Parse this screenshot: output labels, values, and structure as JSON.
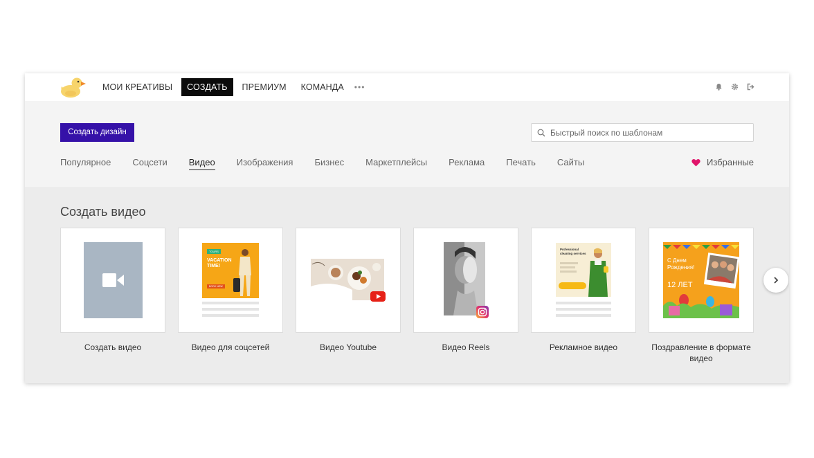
{
  "nav": {
    "items": [
      {
        "label": "МОИ КРЕАТИВЫ",
        "active": false
      },
      {
        "label": "СОЗДАТЬ",
        "active": true
      },
      {
        "label": "ПРЕМИУМ",
        "active": false
      },
      {
        "label": "КОМАНДА",
        "active": false
      }
    ],
    "more": "•••",
    "icons": [
      "bell-icon",
      "gear-icon",
      "logout-icon"
    ]
  },
  "header": {
    "create_button": "Создать дизайн",
    "search_placeholder": "Быстрый поиск по шаблонам",
    "categories": [
      "Популярное",
      "Соцсети",
      "Видео",
      "Изображения",
      "Бизнес",
      "Маркетплейсы",
      "Реклама",
      "Печать",
      "Сайты"
    ],
    "active_category": "Видео",
    "favorites": "Избранные"
  },
  "main": {
    "title": "Создать видео",
    "cards": [
      {
        "label": "Создать видео"
      },
      {
        "label": "Видео для соцсетей",
        "preview": {
          "badge": "TOURS",
          "headline": "VACATION TIME!",
          "button": "BOOK NOW"
        }
      },
      {
        "label": "Видео Youtube"
      },
      {
        "label": "Видео Reels"
      },
      {
        "label": "Рекламное видео",
        "preview": {
          "headline": "Professional cleaning services"
        }
      },
      {
        "label": "Поздравление в формате видео",
        "preview": {
          "line1": "С Днем",
          "line2": "Рождения!",
          "age": "12 ЛЕТ"
        }
      }
    ]
  },
  "colors": {
    "accent": "#3511a8",
    "active_nav": "#0b0b0b",
    "heart": "#e0146a",
    "content_bg": "#ececec",
    "header_bg": "#f4f4f4"
  }
}
